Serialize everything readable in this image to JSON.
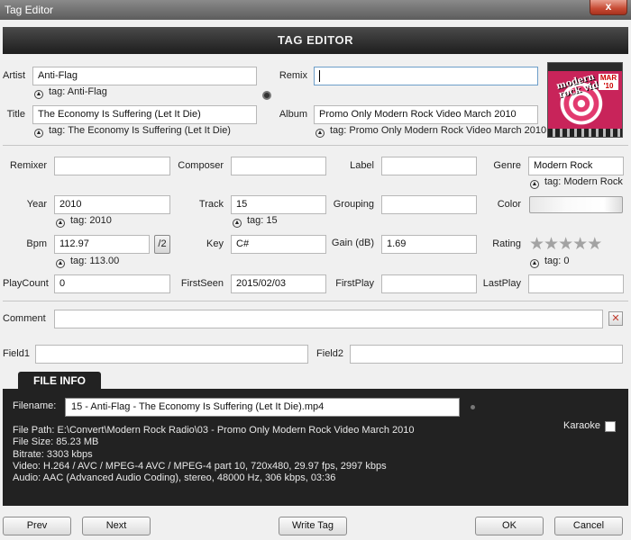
{
  "window": {
    "title": "Tag Editor",
    "close_label": "x"
  },
  "header": {
    "title": "TAG EDITOR"
  },
  "labels": {
    "artist": "Artist",
    "remix": "Remix",
    "title": "Title",
    "album": "Album",
    "remixer": "Remixer",
    "composer": "Composer",
    "label": "Label",
    "genre": "Genre",
    "year": "Year",
    "track": "Track",
    "grouping": "Grouping",
    "color": "Color",
    "bpm": "Bpm",
    "key": "Key",
    "gain": "Gain (dB)",
    "rating": "Rating",
    "playcount": "PlayCount",
    "firstseen": "FirstSeen",
    "firstplay": "FirstPlay",
    "lastplay": "LastPlay",
    "comment": "Comment",
    "field1": "Field1",
    "field2": "Field2"
  },
  "values": {
    "artist": "Anti-Flag",
    "remix": "",
    "title": "The Economy Is Suffering (Let It Die)",
    "album": "Promo Only Modern Rock Video March 2010",
    "remixer": "",
    "composer": "",
    "label": "",
    "genre": "Modern Rock",
    "year": "2010",
    "track": "15",
    "grouping": "",
    "bpm": "112.97",
    "key": "C#",
    "gain": "1.69",
    "playcount": "0",
    "firstseen": "2015/02/03",
    "firstplay": "",
    "lastplay": "",
    "comment": "",
    "field1": "",
    "field2": ""
  },
  "hints": {
    "artist": "tag: Anti-Flag",
    "title": "tag: The Economy Is Suffering (Let It Die)",
    "album": "tag: Promo Only Modern Rock Video March 2010",
    "genre": "tag: Modern Rock",
    "year": "tag: 2010",
    "track": "tag: 15",
    "bpm": "tag: 113.00",
    "rating": "tag: 0"
  },
  "album_art": {
    "line1": "modern rock video",
    "badge": "MAR '10"
  },
  "bpm_half_button": "/2",
  "rating": {
    "value": 0,
    "max": 5,
    "star_color": "#a3a3a3"
  },
  "file_info": {
    "tab_label": "FILE INFO",
    "filename_label": "Filename:",
    "filename": "15 - Anti-Flag - The Economy Is Suffering (Let It Die).mp4",
    "details": [
      "File Path: E:\\Convert\\Modern Rock Radio\\03 - Promo Only Modern Rock Video March 2010",
      "File Size: 85.23 MB",
      "Bitrate: 3303 kbps",
      "Video: H.264 / AVC / MPEG-4 AVC / MPEG-4 part 10, 720x480, 29.97 fps, 2997 kbps",
      "Audio: AAC (Advanced Audio Coding), stereo, 48000 Hz, 306 kbps, 03:36"
    ],
    "karaoke_label": "Karaoke"
  },
  "buttons": {
    "prev": "Prev",
    "next": "Next",
    "write_tag": "Write Tag",
    "ok": "OK",
    "cancel": "Cancel"
  },
  "colors": {
    "header_bg": "#2b2b2b",
    "panel_bg": "#222222",
    "close_red": "#c74a33"
  }
}
